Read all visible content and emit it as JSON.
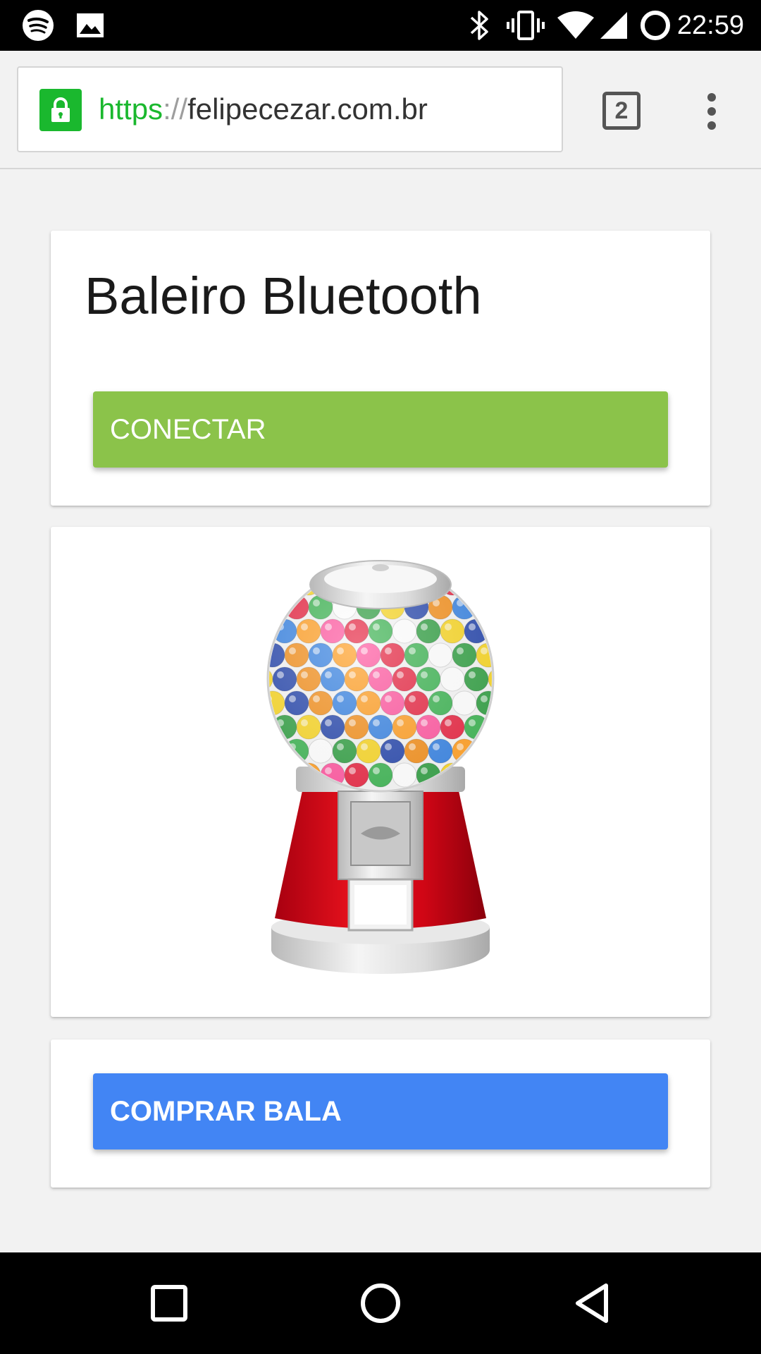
{
  "status_bar": {
    "time": "22:59",
    "icons": [
      "spotify-icon",
      "gallery-icon",
      "bluetooth-icon",
      "vibrate-icon",
      "wifi-icon",
      "signal-icon",
      "battery-icon"
    ]
  },
  "browser": {
    "url_scheme": "https",
    "url_separator": "://",
    "url_host": "felipecezar.com.br",
    "tab_count": "2",
    "secure_color": "#1ab82e"
  },
  "page": {
    "title": "Baleiro Bluetooth",
    "connect_label": "CONECTAR",
    "buy_label": "COMPRAR BALA",
    "connect_color": "#8bc34a",
    "buy_color": "#4285f4",
    "image": "gumball-machine"
  },
  "nav_bar": {
    "buttons": [
      "recents-button",
      "home-button",
      "back-button"
    ]
  }
}
